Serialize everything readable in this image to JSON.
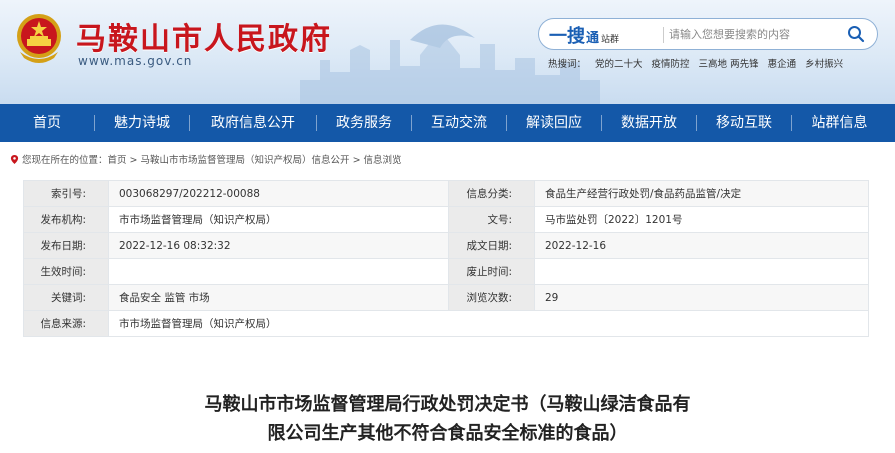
{
  "header": {
    "site_title": "马鞍山市人民政府",
    "site_url": "www.mas.gov.cn",
    "brand_color": "#c8161d"
  },
  "search": {
    "brand_main": "一搜",
    "brand_tong": "通",
    "brand_zq": "站群",
    "placeholder": "请输入您想要搜索的内容",
    "hot_label": "热搜词：",
    "hot_words": [
      "党的二十大",
      "疫情防控",
      "三高地 两先锋",
      "惠企通",
      "乡村振兴"
    ]
  },
  "nav": {
    "color": "#1458a8",
    "items": [
      "首页",
      "魅力诗城",
      "政府信息公开",
      "政务服务",
      "互动交流",
      "解读回应",
      "数据开放",
      "移动互联",
      "站群信息"
    ]
  },
  "breadcrumb": {
    "prefix": "您现在所在的位置：",
    "items": [
      "首页",
      "马鞍山市市场监督管理局（知识产权局）信息公开",
      "信息浏览"
    ],
    "sep": " > "
  },
  "info": {
    "rows": [
      {
        "k1": "索引号:",
        "v1": "003068297/202212-00088",
        "k2": "信息分类:",
        "v2": "食品生产经营行政处罚/食品药品监管/决定"
      },
      {
        "k1": "发布机构:",
        "v1": "市市场监督管理局（知识产权局）",
        "k2": "文号:",
        "v2": "马市监处罚〔2022〕1201号"
      },
      {
        "k1": "发布日期:",
        "v1": "2022-12-16 08:32:32",
        "k2": "成文日期:",
        "v2": "2022-12-16"
      },
      {
        "k1": "生效时间:",
        "v1": "",
        "k2": "废止时间:",
        "v2": ""
      },
      {
        "k1": "关键词:",
        "v1": "食品安全 监管 市场",
        "k2": "浏览次数:",
        "v2": "29"
      },
      {
        "k1": "信息来源:",
        "v1": "市市场监督管理局（知识产权局）"
      }
    ]
  },
  "doc": {
    "title_line1": "马鞍山市市场监督管理局行政处罚决定书（马鞍山绿洁食品有",
    "title_line2": "限公司生产其他不符合食品安全标准的食品）"
  }
}
